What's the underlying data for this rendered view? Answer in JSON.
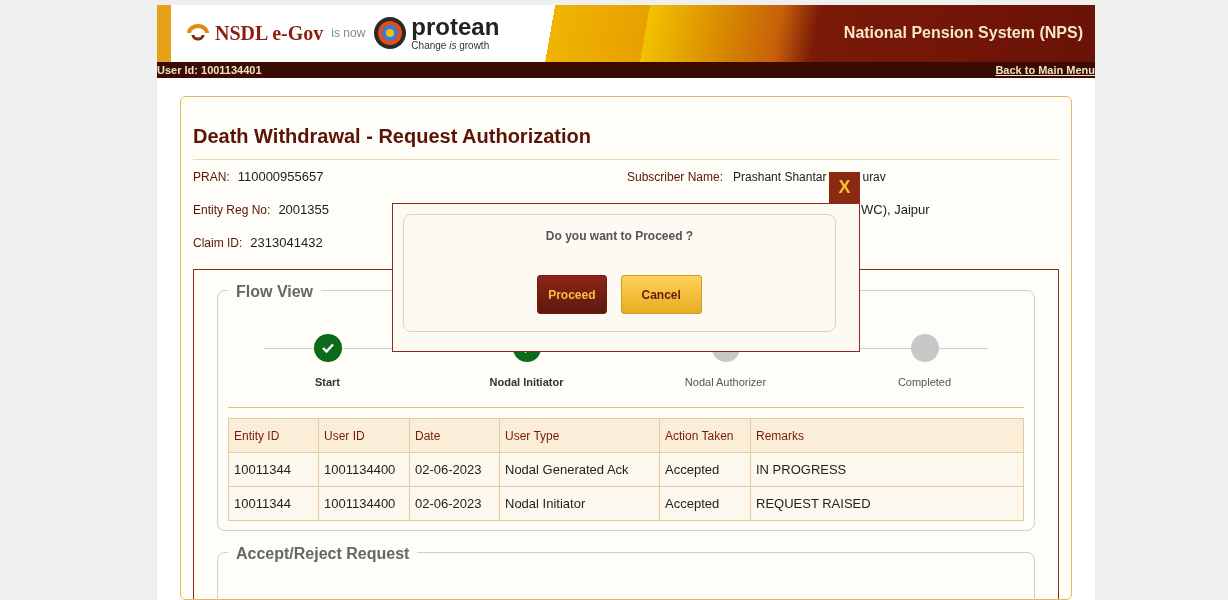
{
  "header": {
    "brand": "NSDL e-Gov",
    "brand_note": "is now",
    "brand_new": "protean",
    "tagline": "Change *is* growth",
    "system_title": "National Pension System (NPS)",
    "user_id": "User Id: 1001134401",
    "back_link": "Back to Main Menu"
  },
  "page": {
    "title": "Death Withdrawal - Request Authorization",
    "fields_left": [
      {
        "label": "PRAN:",
        "value": "110000955657"
      },
      {
        "label": "Entity Reg No:",
        "value": "2001355"
      },
      {
        "label": "Claim ID:",
        "value": "2313041432"
      }
    ],
    "subscriber": {
      "label": "Subscriber Name:",
      "value_start": "Prashant Shantar",
      "value_end": "urav"
    },
    "entity_name_end": "WC), Jaipur"
  },
  "flow_view": {
    "title": "Flow View",
    "steps": [
      {
        "label": "Start",
        "done": true
      },
      {
        "label": "Nodal Initiator",
        "done": true
      },
      {
        "label": "Nodal Authorizer",
        "done": false
      },
      {
        "label": "Completed",
        "done": false
      }
    ],
    "table": {
      "columns": [
        "Entity ID",
        "User ID",
        "Date",
        "User Type",
        "Action Taken",
        "Remarks"
      ],
      "rows": [
        [
          "10011344",
          "1001134400",
          "02-06-2023",
          "Nodal Generated Ack",
          "Accepted",
          "IN PROGRESS"
        ],
        [
          "10011344",
          "1001134400",
          "02-06-2023",
          "Nodal Initiator",
          "Accepted",
          "REQUEST RAISED"
        ]
      ]
    }
  },
  "accept_reject": {
    "title": "Accept/Reject Request"
  },
  "dialog": {
    "close": "X",
    "message": "Do you want to Proceed ?",
    "buttons": [
      {
        "label": "Proceed",
        "kind": "primary"
      },
      {
        "label": "Cancel",
        "kind": "secondary"
      }
    ]
  }
}
